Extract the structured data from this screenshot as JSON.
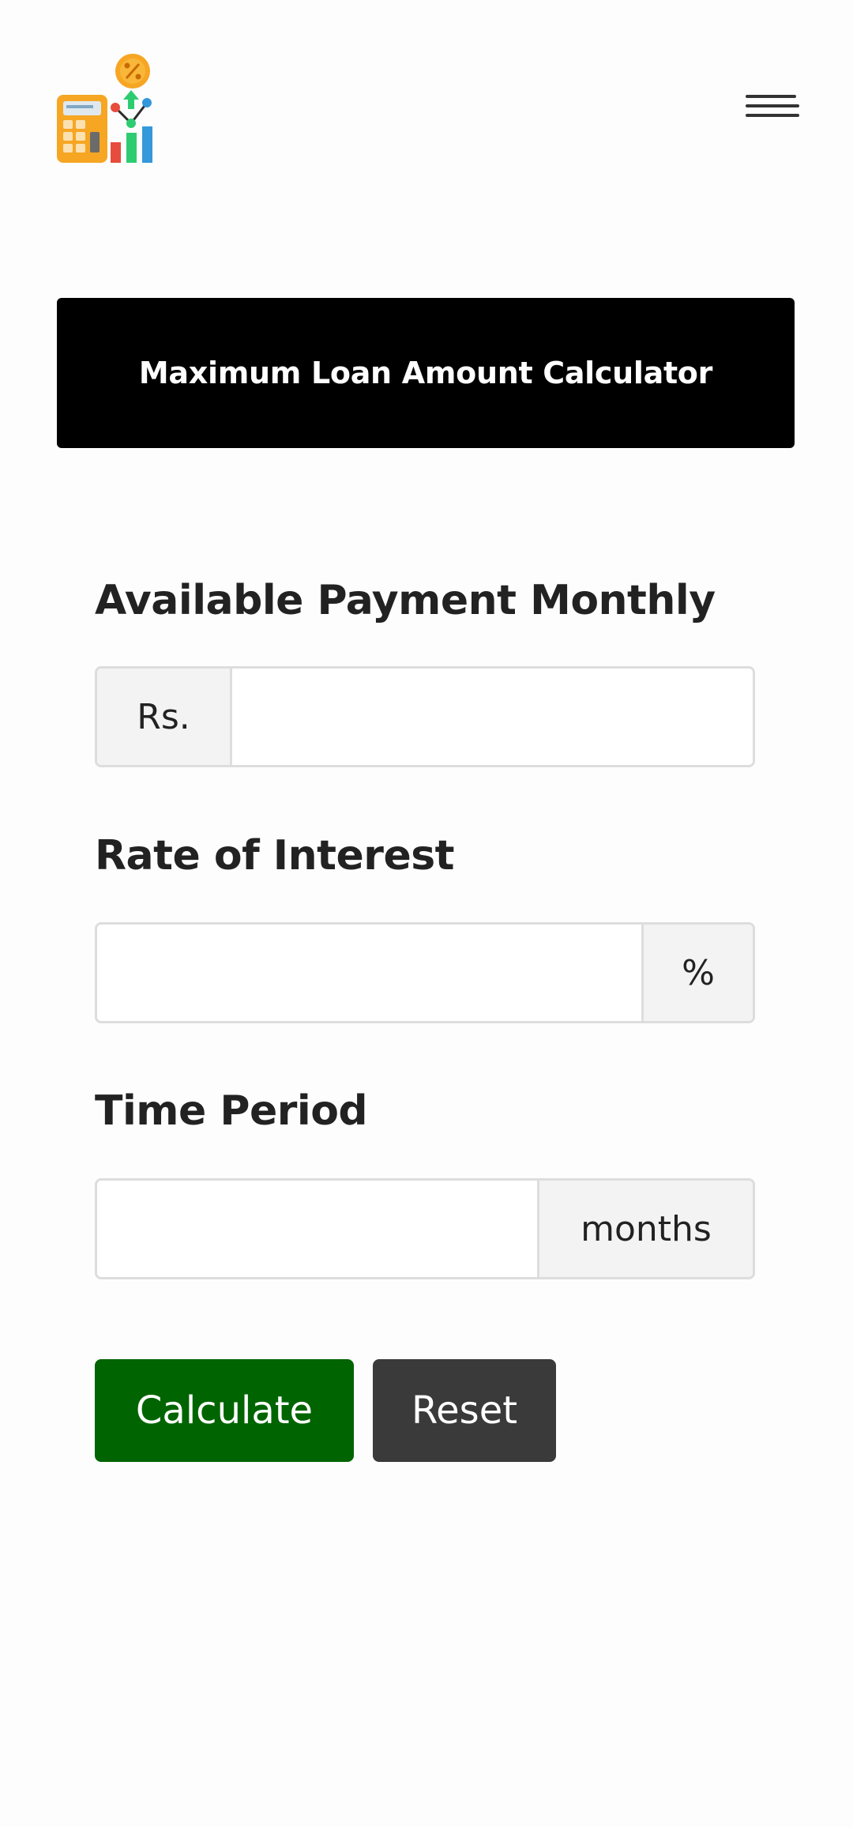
{
  "header": {
    "logo_icon": "calculator-chart-percent-icon",
    "menu_icon": "hamburger-menu-icon"
  },
  "title": "Maximum Loan Amount Calculator",
  "form": {
    "monthly_payment": {
      "label": "Available Payment Monthly",
      "prefix": "Rs.",
      "value": ""
    },
    "interest_rate": {
      "label": "Rate of Interest",
      "suffix": "%",
      "value": ""
    },
    "time_period": {
      "label": "Time Period",
      "suffix": "months",
      "value": ""
    }
  },
  "buttons": {
    "calculate": "Calculate",
    "reset": "Reset"
  },
  "colors": {
    "banner_bg": "#000000",
    "calculate_bg": "#006400",
    "reset_bg": "#3a3a3a",
    "border": "#dddddd",
    "addon_bg": "#f3f3f3"
  }
}
